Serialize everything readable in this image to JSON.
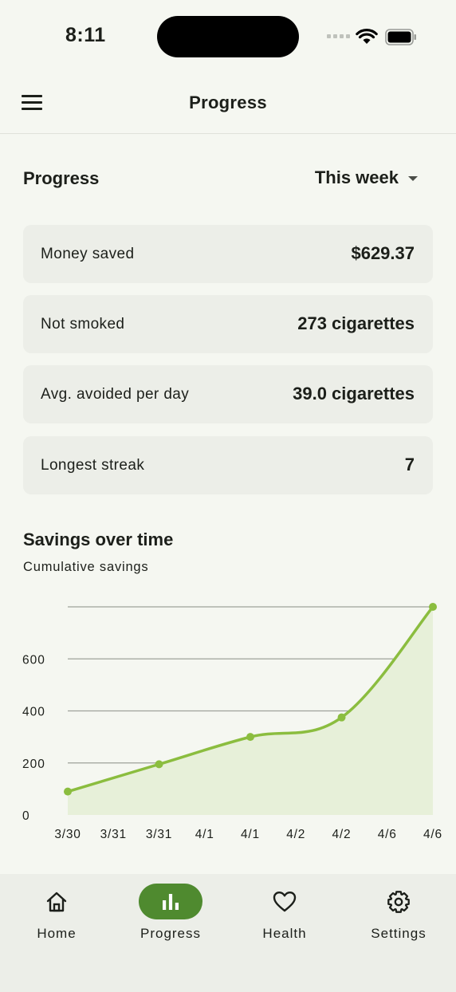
{
  "status_bar": {
    "time": "8:11"
  },
  "app_bar": {
    "title": "Progress",
    "menu_icon": "hamburger-menu-icon"
  },
  "header": {
    "title": "Progress",
    "period": "This week"
  },
  "stats": [
    {
      "label": "Money saved",
      "value": "$629.37"
    },
    {
      "label": "Not smoked",
      "value": "273 cigarettes"
    },
    {
      "label": "Avg. avoided per day",
      "value": "39.0 cigarettes"
    },
    {
      "label": "Longest streak",
      "value": "7"
    }
  ],
  "chart_section": {
    "title": "Savings over time",
    "subtitle": "Cumulative savings"
  },
  "chart_data": {
    "type": "area",
    "title": "Savings over time",
    "subtitle": "Cumulative savings",
    "categories": [
      "3/30",
      "3/31",
      "3/31",
      "4/1",
      "4/1",
      "4/2",
      "4/2",
      "4/6",
      "4/6"
    ],
    "yticks": [
      "0",
      "200",
      "400",
      "600"
    ],
    "ylim": [
      0,
      800
    ],
    "grid": true,
    "series": [
      {
        "points": [
          {
            "x": 0,
            "y": 90
          },
          {
            "x": 2,
            "y": 195
          },
          {
            "x": 4,
            "y": 300
          },
          {
            "x": 6,
            "y": 375
          },
          {
            "x": 8,
            "y": 800
          }
        ],
        "color": "#8bbd3f",
        "fill": "#e7f0d9"
      }
    ]
  },
  "bottom_nav": [
    {
      "label": "Home",
      "icon": "home-icon",
      "active": false
    },
    {
      "label": "Progress",
      "icon": "bar-chart-icon",
      "active": true
    },
    {
      "label": "Health",
      "icon": "heart-icon",
      "active": false
    },
    {
      "label": "Settings",
      "icon": "gear-icon",
      "active": false
    }
  ],
  "colors": {
    "background": "#f5f7f1",
    "card": "#eceee8",
    "accent": "#4f8a2f",
    "line": "#8bbd3f",
    "area_fill": "#e7f0d9"
  }
}
